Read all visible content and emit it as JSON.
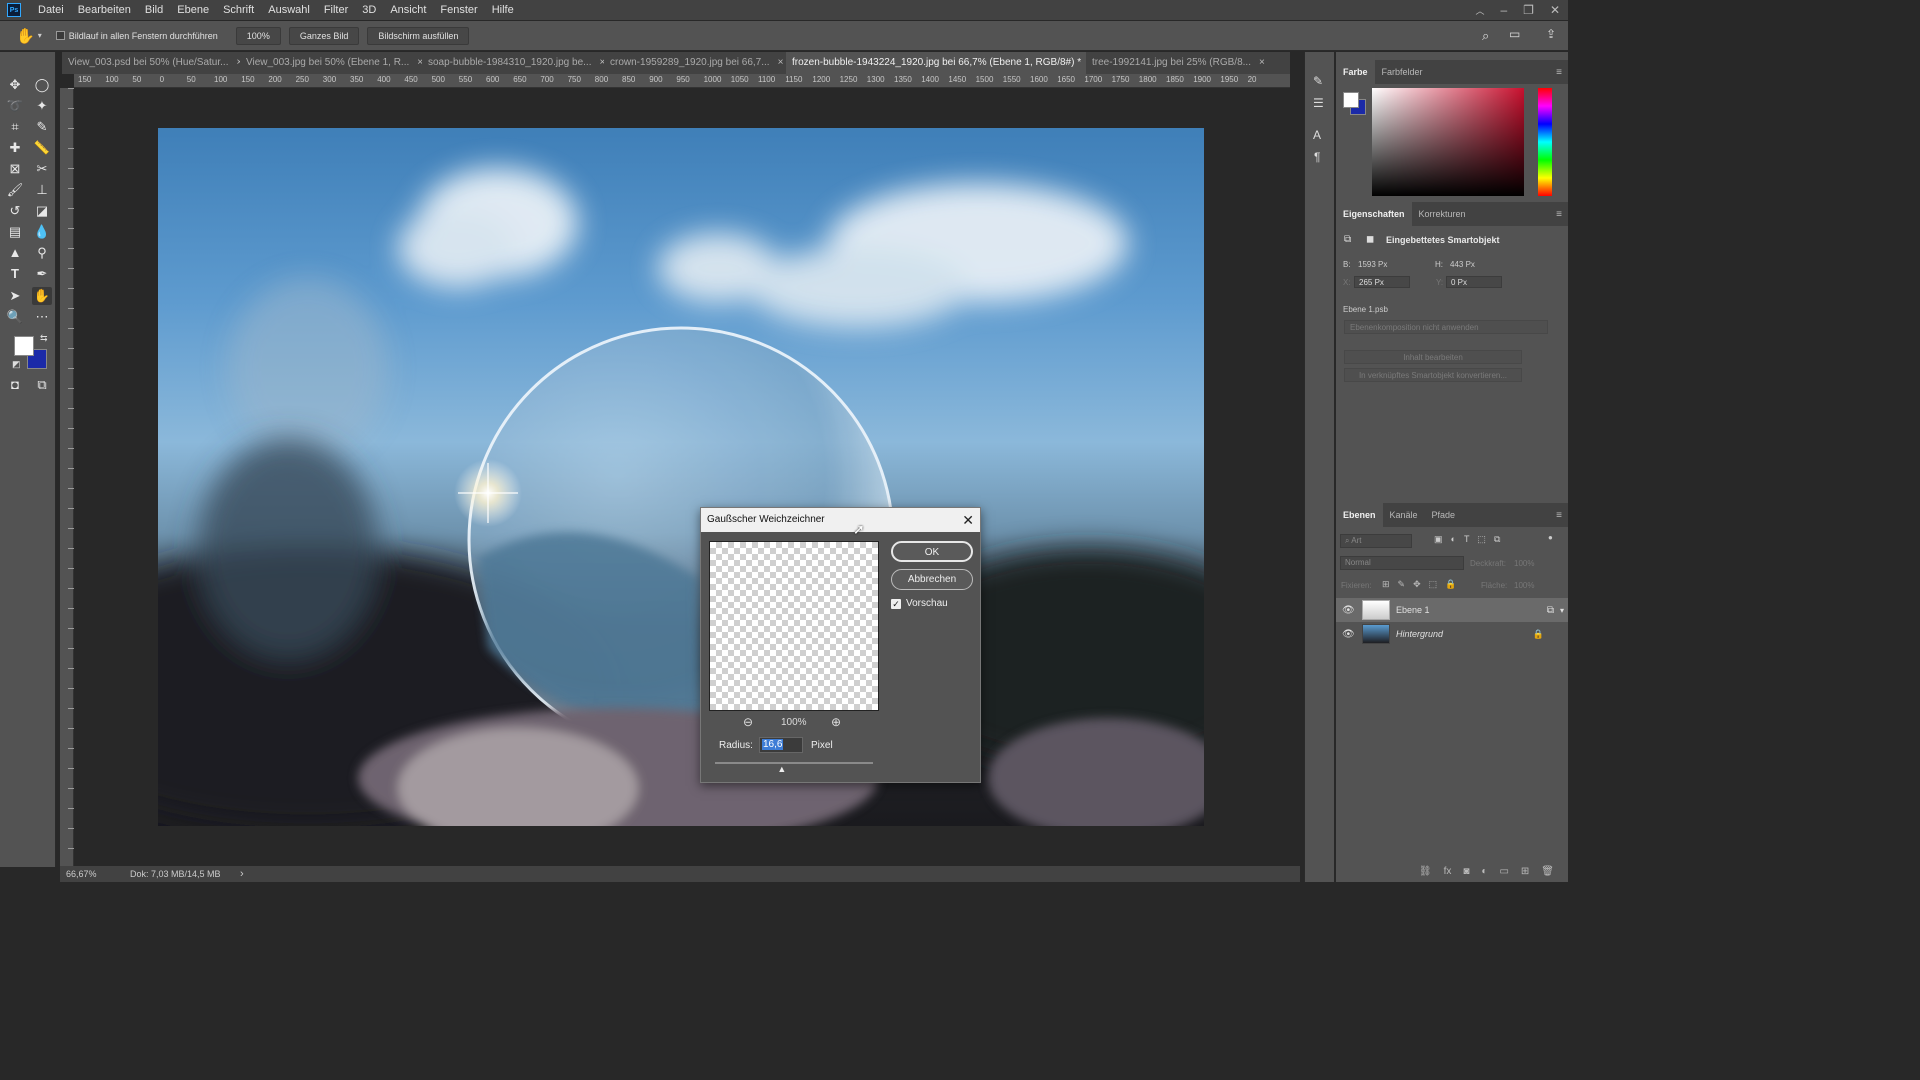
{
  "app": {
    "logo": "Ps"
  },
  "menu": [
    "Datei",
    "Bearbeiten",
    "Bild",
    "Ebene",
    "Schrift",
    "Auswahl",
    "Filter",
    "3D",
    "Ansicht",
    "Fenster",
    "Hilfe"
  ],
  "options": {
    "scroll_all_label": "Bildlauf in allen Fenstern durchführen",
    "zoom_value": "100%",
    "fit_label": "Ganzes Bild",
    "fill_label": "Bildschirm ausfüllen"
  },
  "tabs": [
    {
      "label": "View_003.psd bei 50% (Hue/Satur...",
      "close": "×"
    },
    {
      "label": "View_003.jpg bei 50% (Ebene 1, R...",
      "close": "×"
    },
    {
      "label": "soap-bubble-1984310_1920.jpg be...",
      "close": "×"
    },
    {
      "label": "crown-1959289_1920.jpg bei 66,7...",
      "close": "×"
    },
    {
      "label": "frozen-bubble-1943224_1920.jpg bei 66,7% (Ebene 1, RGB/8#) *",
      "close": "×"
    },
    {
      "label": "tree-1992141.jpg bei 25% (RGB/8...",
      "close": "×"
    }
  ],
  "ruler_h": [
    "150",
    "100",
    "50",
    "0",
    "50",
    "100",
    "150",
    "200",
    "250",
    "300",
    "350",
    "400",
    "450",
    "500",
    "550",
    "600",
    "650",
    "700",
    "750",
    "800",
    "850",
    "900",
    "950",
    "1000",
    "1050",
    "1100",
    "1150",
    "1200",
    "1250",
    "1300",
    "1350",
    "1400",
    "1450",
    "1500",
    "1550",
    "1600",
    "1650",
    "1700",
    "1750",
    "1800",
    "1850",
    "1900",
    "1950",
    "20"
  ],
  "statusbar": {
    "zoom": "66,67%",
    "doc": "Dok: 7,03 MB/14,5 MB",
    "arrow": "›"
  },
  "color_panel": {
    "tab_active": "Farbe",
    "tab_other": "Farbfelder",
    "hue_color": "#c8102e"
  },
  "properties": {
    "tab_active": "Eigenschaften",
    "tab_other": "Korrekturen",
    "type_label": "Eingebettetes Smartobjekt",
    "w_label": "B:",
    "w_value": "1593 Px",
    "h_label": "H:",
    "h_value": "443 Px",
    "x_label": "X:",
    "x_value": "265 Px",
    "y_label": "Y:",
    "y_value": "0 Px",
    "file": "Ebene 1.psb",
    "comp_placeholder": "Ebenenkomposition nicht anwenden",
    "edit_btn": "Inhalt bearbeiten",
    "convert_btn": "In verknüpftes Smartobjekt konvertieren..."
  },
  "layers_panel": {
    "tab_active": "Ebenen",
    "tab_2": "Kanäle",
    "tab_3": "Pfade",
    "search_placeholder": "Art",
    "blend_mode": "Normal",
    "opacity_label": "Deckkraft:",
    "opacity_value": "100%",
    "lock_label": "Fixieren:",
    "fill_label": "Fläche:",
    "fill_value": "100%",
    "layers": [
      {
        "name": "Ebene 1"
      },
      {
        "name": "Hintergrund"
      }
    ]
  },
  "dialog": {
    "title": "Gaußscher Weichzeichner",
    "ok": "OK",
    "cancel": "Abbrechen",
    "preview_label": "Vorschau",
    "preview_checked": true,
    "zoom": "100%",
    "radius_label": "Radius:",
    "radius_value": "16,6",
    "unit": "Pixel",
    "slider_fraction": 0.42
  }
}
